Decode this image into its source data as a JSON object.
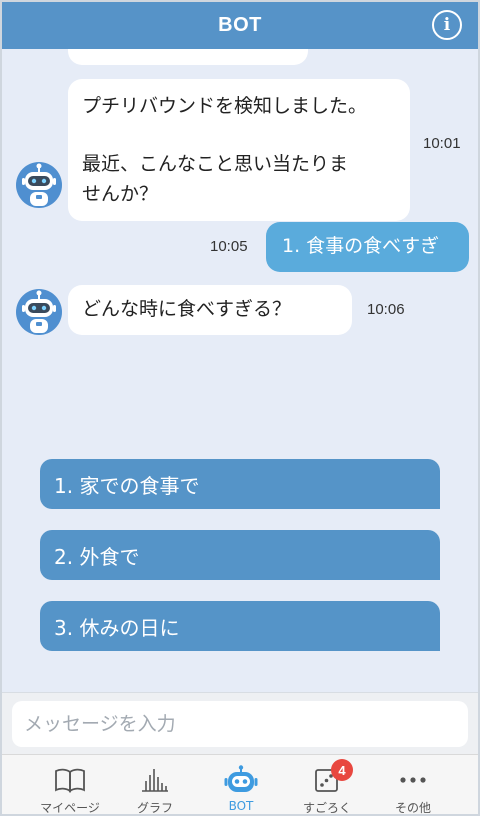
{
  "header": {
    "title": "BOT",
    "info_icon": "info-icon"
  },
  "messages": [
    {
      "from": "bot",
      "lines": [
        "プチリバウンドを検知しました。",
        "",
        "最近、こんなこと思い当たりま",
        "せんか？"
      ],
      "time": "10:01"
    },
    {
      "from": "user",
      "text": "1. 食事の食べすぎ",
      "time": "10:05"
    },
    {
      "from": "bot",
      "text": "どんな時に食べすぎる？",
      "time": "10:06"
    }
  ],
  "choices": [
    "1. 家での食事で",
    "2. 外食で",
    "3. 休みの日に"
  ],
  "input": {
    "placeholder": "メッセージを入力"
  },
  "tabs": [
    {
      "label": "マイページ",
      "icon": "book-icon"
    },
    {
      "label": "グラフ",
      "icon": "bar-chart-icon"
    },
    {
      "label": "BOT",
      "icon": "robot-icon",
      "active": true
    },
    {
      "label": "すごろく",
      "icon": "dice-icon",
      "badge": "4"
    },
    {
      "label": "その他",
      "icon": "more-icon"
    }
  ],
  "colors": {
    "header": "#5693c8",
    "user_bubble": "#5aabdc",
    "choice": "#5594c8",
    "active_tab": "#3e9be0",
    "badge": "#e8473f",
    "background": "#e6ecf7"
  }
}
